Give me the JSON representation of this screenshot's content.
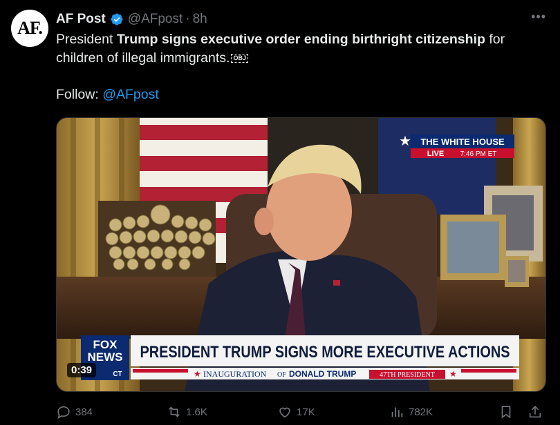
{
  "author": {
    "avatar_text": "AF.",
    "name": "AF Post",
    "handle": "@AFpost",
    "time": "8h",
    "separator": "·"
  },
  "more_label": "•••",
  "tweet": {
    "text_part1": "President ",
    "text_bold": "Trump signs executive order ending birthright citizenship",
    "text_part2": " for children of illegal immigrants.",
    "obj_badge": "OBJ",
    "follow_label": "Follow: ",
    "follow_link": "@AFpost"
  },
  "video": {
    "duration": "0:39",
    "bug_title": "THE WHITE HOUSE",
    "bug_live": "LIVE",
    "bug_time": "7:46 PM ET",
    "network_line1": "FOX",
    "network_line2": "NEWS",
    "network_line3": "CT",
    "headline": "PRESIDENT TRUMP SIGNS MORE EXECUTIVE ACTIONS",
    "ticker_a": "INAUGURATION",
    "ticker_of": "OF",
    "ticker_b": "DONALD TRUMP",
    "ticker_c": "47TH PRESIDENT",
    "ticker_star": "★"
  },
  "actions": {
    "replies": "384",
    "reposts": "1.6K",
    "likes": "17K",
    "views": "782K"
  },
  "colors": {
    "accent": "#1d9bf0",
    "muted": "#71767b",
    "text": "#e7e9ea",
    "lower_third_red": "#c8102e",
    "lower_third_navy": "#0b2a6f"
  },
  "icons": [
    "verified-badge-icon",
    "more-icon",
    "reply-icon",
    "repost-icon",
    "like-icon",
    "views-icon",
    "bookmark-icon",
    "share-icon"
  ]
}
